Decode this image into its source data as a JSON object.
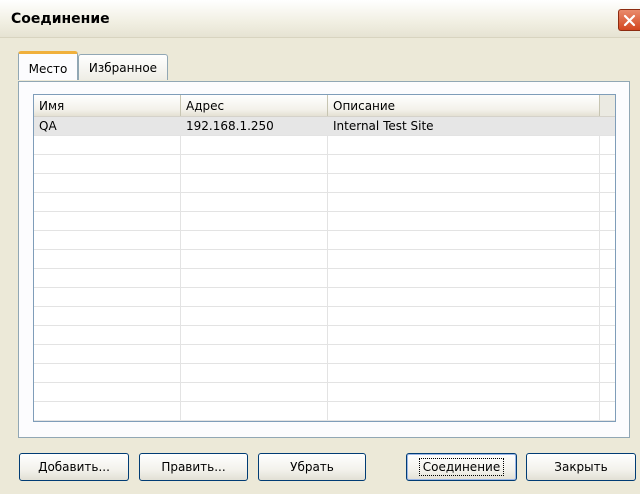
{
  "window": {
    "title": "Соединение"
  },
  "tabs": [
    {
      "label": "Место",
      "active": true
    },
    {
      "label": "Избранное",
      "active": false
    }
  ],
  "table": {
    "columns": [
      "Имя",
      "Адрес",
      "Описание"
    ],
    "rows": [
      {
        "name": "QA",
        "address": "192.168.1.250",
        "description": "Internal Test Site",
        "selected": true
      }
    ]
  },
  "buttons": {
    "add": "Добавить...",
    "edit": "Править...",
    "remove": "Убрать",
    "connect": "Соединение",
    "close": "Закрыть"
  },
  "colors": {
    "accent_tab": "#f0b03c",
    "close_button": "#d3461f",
    "selection": "#e6e6e6"
  }
}
